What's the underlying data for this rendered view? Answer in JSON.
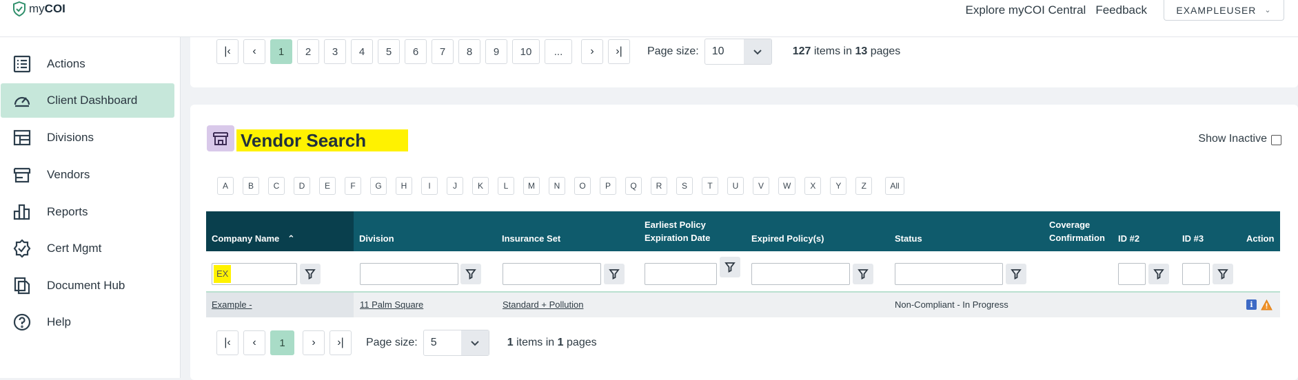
{
  "header": {
    "logo_prefix": "my",
    "logo_bold": "COI",
    "explore_link": "Explore myCOI Central",
    "feedback_link": "Feedback",
    "user_name": "EXAMPLEUSER"
  },
  "sidebar": {
    "items": [
      {
        "label": "Actions",
        "icon": "list-icon"
      },
      {
        "label": "Client Dashboard",
        "icon": "dashboard-gauge-icon",
        "active": true
      },
      {
        "label": "Divisions",
        "icon": "divisions-grid-icon"
      },
      {
        "label": "Vendors",
        "icon": "storefront-icon"
      },
      {
        "label": "Reports",
        "icon": "bar-chart-icon"
      },
      {
        "label": "Cert Mgmt",
        "icon": "badge-check-icon"
      },
      {
        "label": "Document Hub",
        "icon": "documents-icon"
      },
      {
        "label": "Help",
        "icon": "help-circle-icon"
      }
    ]
  },
  "top_pager": {
    "pages": [
      "1",
      "2",
      "3",
      "4",
      "5",
      "6",
      "7",
      "8",
      "9",
      "10",
      "..."
    ],
    "current": "1",
    "page_size_label": "Page size:",
    "page_size": "10",
    "total_items": "127",
    "items_text": "items in",
    "total_pages": "13",
    "pages_text": "pages"
  },
  "vendor_search": {
    "title": "Vendor Search",
    "show_inactive_label": "Show Inactive",
    "letters": [
      "A",
      "B",
      "C",
      "D",
      "E",
      "F",
      "G",
      "H",
      "I",
      "J",
      "K",
      "L",
      "M",
      "N",
      "O",
      "P",
      "Q",
      "R",
      "S",
      "T",
      "U",
      "V",
      "W",
      "X",
      "Y",
      "Z",
      "All"
    ]
  },
  "table": {
    "columns": {
      "company_name": "Company Name",
      "division": "Division",
      "insurance_set": "Insurance Set",
      "earliest_line1": "Earliest Policy",
      "earliest_line2": "Expiration Date",
      "expired": "Expired Policy(s)",
      "status": "Status",
      "coverage_line1": "Coverage",
      "coverage_line2": "Confirmation",
      "id2": "ID #2",
      "id3": "ID #3",
      "action": "Action"
    },
    "filters": {
      "company_name": "EX"
    },
    "rows": [
      {
        "company_name": "Example -",
        "division": "11 Palm Square",
        "insurance_set": "Standard + Pollution",
        "status": "Non-Compliant - In Progress"
      }
    ]
  },
  "bottom_pager": {
    "current": "1",
    "page_size_label": "Page size:",
    "page_size": "5",
    "total_items": "1",
    "items_text": "items in",
    "total_pages": "1",
    "pages_text": "pages"
  },
  "colors": {
    "table_header": "#0f5b6c",
    "table_header_sorted": "#093f4d",
    "active_nav": "#c6e7da",
    "current_page": "#a9dcc7",
    "highlight": "#fff200",
    "vendor_icon_bg": "#d9c9ea"
  }
}
